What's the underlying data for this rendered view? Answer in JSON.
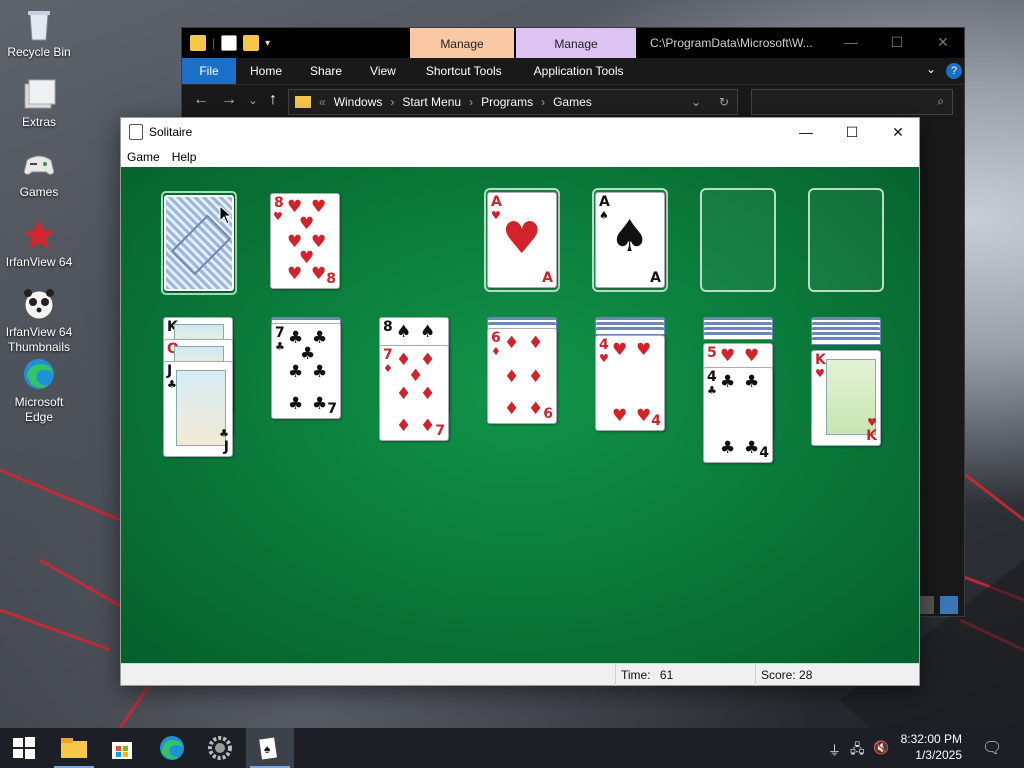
{
  "desktop": {
    "icons": [
      {
        "label": "Recycle Bin",
        "icon": "recycle-bin-icon"
      },
      {
        "label": "Extras",
        "icon": "folder-stack-icon"
      },
      {
        "label": "Games",
        "icon": "gamepad-icon"
      },
      {
        "label": "IrfanView 64",
        "icon": "irfanview-icon"
      },
      {
        "label": "IrfanView 64 Thumbnails",
        "icon": "irfanview-thumbnails-icon"
      },
      {
        "label": "Microsoft Edge",
        "icon": "edge-icon"
      }
    ]
  },
  "explorer": {
    "manage_tab_1": "Manage",
    "manage_tab_2": "Manage",
    "title_path": "C:\\ProgramData\\Microsoft\\W...",
    "ribbon_tabs": [
      "File",
      "Home",
      "Share",
      "View",
      "Shortcut Tools",
      "Application Tools"
    ],
    "breadcrumb": [
      "Windows",
      "Start Menu",
      "Programs",
      "Games"
    ],
    "colors": {
      "file_tab": "#1a6fc6",
      "manage_1": "#f9c9a6",
      "manage_2": "#dcc3f2"
    }
  },
  "solitaire": {
    "title": "Solitaire",
    "menu": [
      "Game",
      "Help"
    ],
    "status": {
      "time_label": "Time:",
      "time_value": "61",
      "score_label": "Score: 28"
    },
    "waste": {
      "rank": "8",
      "suit": "♥"
    },
    "foundations": [
      {
        "rank": "A",
        "suit": "♥",
        "color": "red"
      },
      {
        "rank": "A",
        "suit": "♠",
        "color": "black"
      },
      {
        "rank": "",
        "suit": "",
        "color": "empty"
      },
      {
        "rank": "",
        "suit": "",
        "color": "empty"
      }
    ],
    "tableau": [
      {
        "hidden": 0,
        "visible": [
          "K",
          "Q",
          "J"
        ],
        "top_suit": "♣"
      },
      {
        "hidden": 1,
        "visible": [
          "7"
        ],
        "top_suit": "♣"
      },
      {
        "hidden": 0,
        "visible": [
          "8",
          "7"
        ],
        "top_suit": "♦"
      },
      {
        "hidden": 2,
        "visible": [
          "6"
        ],
        "top_suit": "♦"
      },
      {
        "hidden": 3,
        "visible": [
          "4"
        ],
        "top_suit": "♥"
      },
      {
        "hidden": 4,
        "visible": [
          "5",
          "4"
        ],
        "top_suit": "♣"
      },
      {
        "hidden": 5,
        "visible": [
          "K"
        ],
        "top_suit": "♥"
      }
    ],
    "felt_color": "#0b7d3c"
  },
  "taskbar": {
    "apps": [
      "start-icon",
      "file-explorer-icon",
      "store-icon",
      "edge-icon",
      "settings-gear-icon",
      "solitaire-icon"
    ],
    "clock_time": "8:32:00 PM",
    "clock_date": "1/3/2025"
  }
}
